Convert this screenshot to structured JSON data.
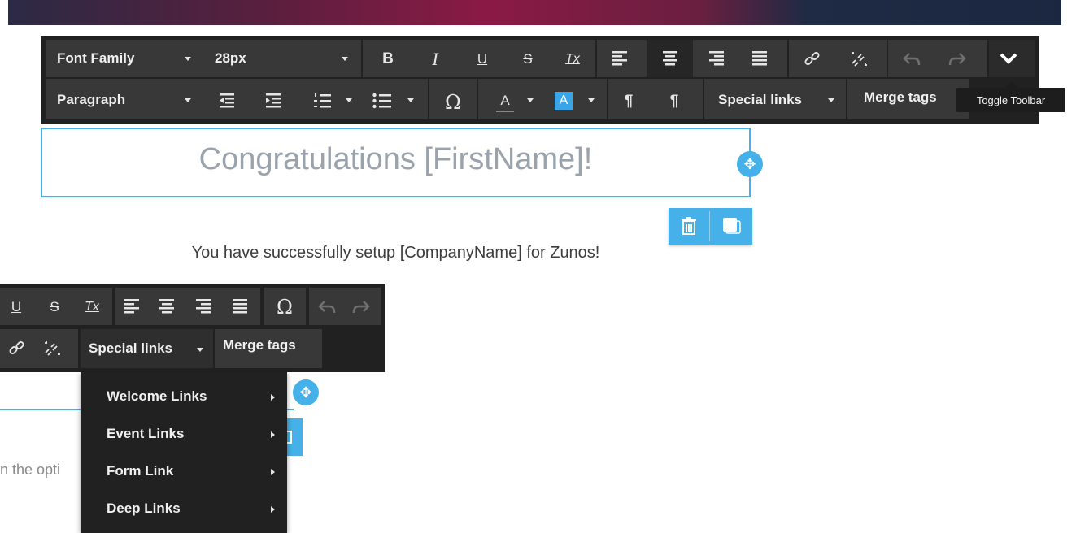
{
  "toolbar_top": {
    "row1": {
      "font_family": "Font Family",
      "font_size": "28px",
      "bold": "B",
      "italic": "I",
      "underline": "U",
      "strikethrough": "S",
      "clear_format": "Tx"
    },
    "row2": {
      "block_format": "Paragraph",
      "special_links": "Special links",
      "merge_tags": "Merge tags",
      "omega": "Ω",
      "text_color": "A",
      "bg_color": "A",
      "ltr": "¶",
      "rtl": "¶"
    },
    "toggle_tooltip": "Toggle Toolbar"
  },
  "editor": {
    "heading": "Congratulations [FirstName]!",
    "subtitle": "You have successfully setup [CompanyName] for Zunos!"
  },
  "toolbar_bottom": {
    "underline": "U",
    "strikethrough": "S",
    "clear_format": "Tx",
    "omega": "Ω",
    "special_links": "Special links",
    "merge_tags": "Merge tags"
  },
  "dropdown": {
    "items": [
      "Welcome Links",
      "Event Links",
      "Form Link",
      "Deep Links"
    ]
  },
  "partial_text": "n the opti",
  "colors": {
    "accent": "#45b1e8",
    "toolbar_bg": "#212121",
    "group_bg": "#383838"
  }
}
